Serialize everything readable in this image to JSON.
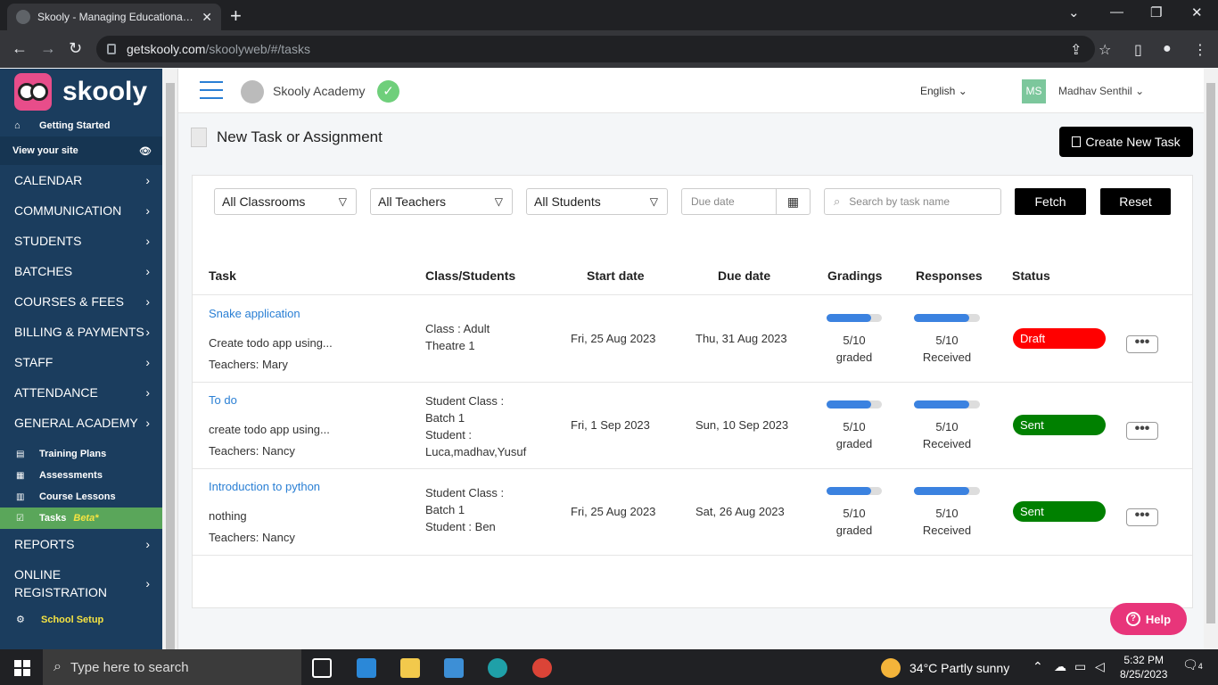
{
  "browser": {
    "tab_title": "Skooly - Managing Educational Jo",
    "url_host": "getskooly.com",
    "url_path": "/skoolyweb/#/tasks"
  },
  "sidebar": {
    "brand": "skooly",
    "getting_started": "Getting Started",
    "view_site": "View your site",
    "menus_top": [
      "CALENDAR",
      "COMMUNICATION",
      "STUDENTS",
      "BATCHES",
      "COURSES & FEES",
      "BILLING & PAYMENTS",
      "STAFF",
      "ATTENDANCE",
      "GENERAL ACADEMY"
    ],
    "subs": [
      "Training Plans",
      "Assessments",
      "Course Lessons"
    ],
    "active_sub": "Tasks",
    "beta": "Beta*",
    "reports": "REPORTS",
    "online_reg_1": "ONLINE",
    "online_reg_2": "REGISTRATION",
    "school_setup": "School Setup"
  },
  "header": {
    "academy": "Skooly Academy",
    "language": "English",
    "user_initials": "MS",
    "user_name": "Madhav Senthil"
  },
  "page": {
    "title": "New Task or Assignment",
    "create_button": "Create New Task"
  },
  "filters": {
    "classrooms": "All Classrooms",
    "teachers": "All Teachers",
    "students": "All Students",
    "due_placeholder": "Due date",
    "search_placeholder": "Search by task name",
    "fetch": "Fetch",
    "reset": "Reset"
  },
  "table": {
    "headers": [
      "Task",
      "Class/Students",
      "Start date",
      "Due date",
      "Gradings",
      "Responses",
      "Status"
    ],
    "rows": [
      {
        "name": "Snake application",
        "desc": "Create todo app using...",
        "teachers": "Teachers: Mary",
        "cls1": "Class : Adult",
        "cls2": "Theatre 1",
        "cls3": "",
        "cls4": "",
        "start": "Fri, 25 Aug 2023",
        "due": "Thu, 31 Aug 2023",
        "grade_num": "5/10",
        "grade_lbl": "graded",
        "resp_num": "5/10",
        "resp_lbl": "Received",
        "grade_frac": 0.8,
        "resp_frac": 0.84,
        "status": "Draft",
        "status_color": "#ff0000"
      },
      {
        "name": "To do",
        "desc": "create todo app using...",
        "teachers": "Teachers: Nancy",
        "cls1": "Student Class :",
        "cls2": "Batch 1",
        "cls3": "Student :",
        "cls4": "Luca,madhav,Yusuf",
        "start": "Fri, 1 Sep 2023",
        "due": "Sun, 10 Sep 2023",
        "grade_num": "5/10",
        "grade_lbl": "graded",
        "resp_num": "5/10",
        "resp_lbl": "Received",
        "grade_frac": 0.8,
        "resp_frac": 0.84,
        "status": "Sent",
        "status_color": "#008000"
      },
      {
        "name": "Introduction to python",
        "desc": "nothing",
        "teachers": "Teachers: Nancy",
        "cls1": "Student Class :",
        "cls2": "Batch 1",
        "cls3": "Student : Ben",
        "cls4": "",
        "start": "Fri, 25 Aug 2023",
        "due": "Sat, 26 Aug 2023",
        "grade_num": "5/10",
        "grade_lbl": "graded",
        "resp_num": "5/10",
        "resp_lbl": "Received",
        "grade_frac": 0.8,
        "resp_frac": 0.84,
        "status": "Sent",
        "status_color": "#008000"
      }
    ]
  },
  "help": "Help",
  "taskbar": {
    "search": "Type here to search",
    "weather": "34°C  Partly sunny",
    "time": "5:32 PM",
    "date": "8/25/2023",
    "notif": "4"
  }
}
